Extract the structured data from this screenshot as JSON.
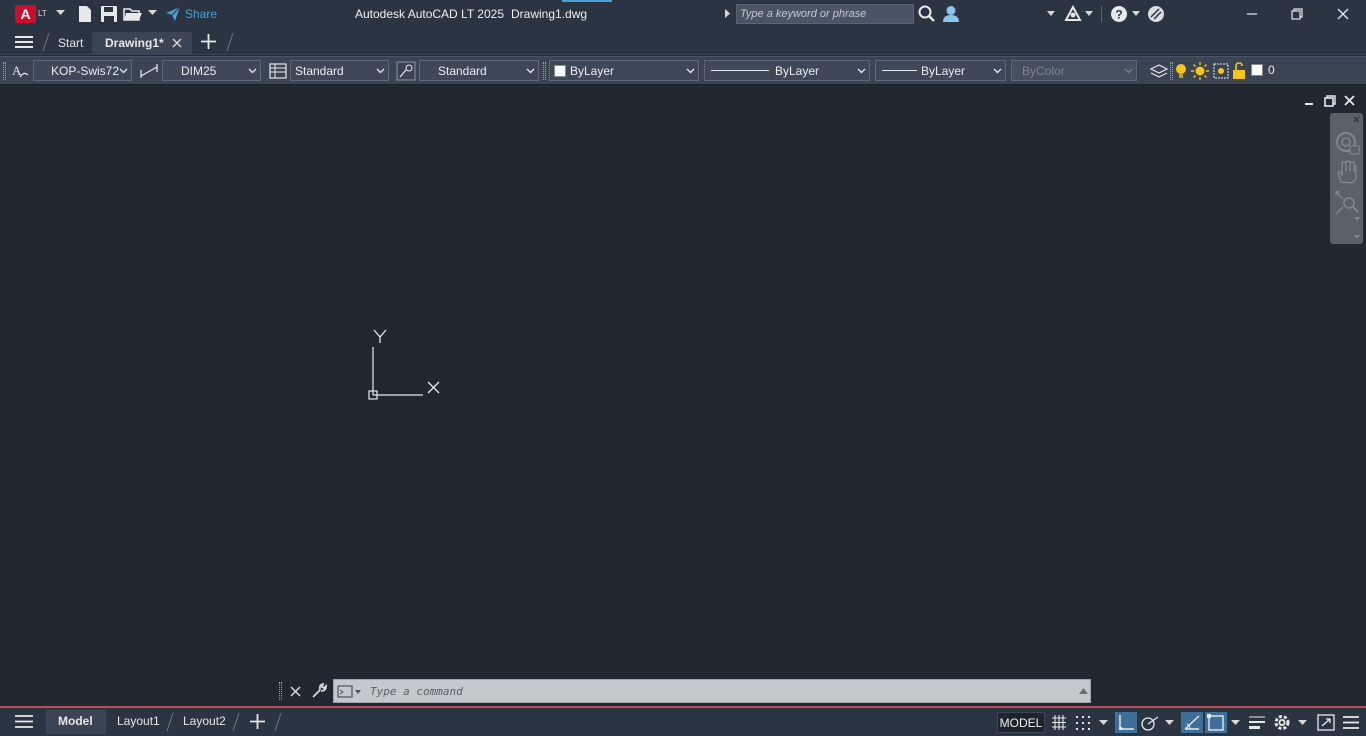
{
  "app": {
    "name": "Autodesk AutoCAD LT 2025",
    "document": "Drawing1.dwg",
    "logo_letter": "A",
    "logo_badge": "LT",
    "share_label": "Share"
  },
  "search": {
    "placeholder": "Type a keyword or phrase"
  },
  "tabs": [
    {
      "label": "Start"
    },
    {
      "label": "Drawing1*"
    }
  ],
  "properties_toolbar": {
    "text_style": "KOP-Swis72",
    "dim_style": "DIM25",
    "table_style": "Standard",
    "multileader_style": "Standard",
    "color": "ByLayer",
    "linetype": "ByLayer",
    "lineweight": "ByLayer",
    "plot_style": "ByColor",
    "layer": "0"
  },
  "ucs": {
    "x_label": "X",
    "y_label": "Y"
  },
  "command_line": {
    "placeholder": "Type  a  command"
  },
  "layout_tabs": [
    {
      "label": "Model"
    },
    {
      "label": "Layout1"
    },
    {
      "label": "Layout2"
    }
  ],
  "status": {
    "space_label": "MODEL"
  },
  "colors": {
    "accent": "#4a9fd8",
    "logo": "#c8102e",
    "canvas": "#212830",
    "toggle_on": "#3e6f98"
  }
}
